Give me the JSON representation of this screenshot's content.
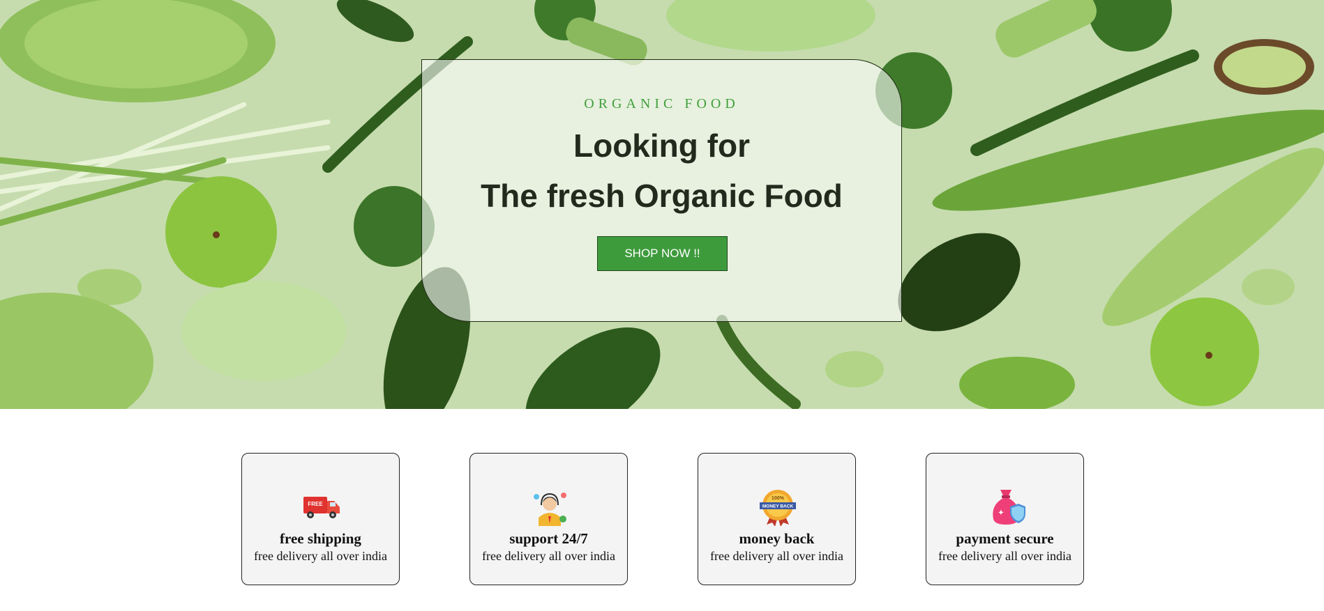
{
  "hero": {
    "eyebrow": "ORGANIC FOOD",
    "headline_line1": "Looking for",
    "headline_line2": "The fresh Organic Food",
    "cta_label": "SHOP NOW !!",
    "accent_color": "#3e9b3c",
    "background_image": "vegetables-on-green-background"
  },
  "features": [
    {
      "icon": "free-shipping-truck-icon",
      "title": "free shipping",
      "description": "free delivery all over india"
    },
    {
      "icon": "support-agent-icon",
      "title": "support 24/7",
      "description": "free delivery all over india"
    },
    {
      "icon": "money-back-badge-icon",
      "title": "money back",
      "description": "free delivery all over india"
    },
    {
      "icon": "secure-payment-bag-icon",
      "title": "payment secure",
      "description": "free delivery all over india"
    }
  ]
}
